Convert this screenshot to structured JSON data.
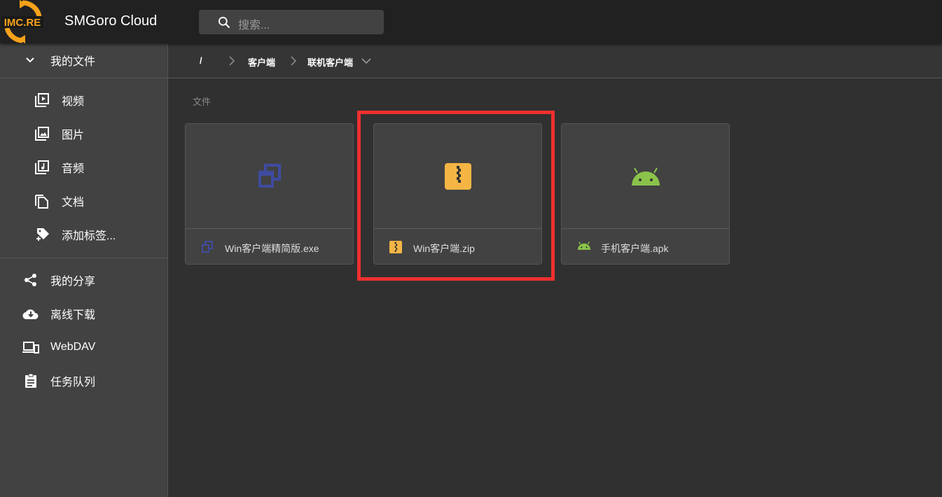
{
  "header": {
    "logo_text": "IMC.RE",
    "title": "SMGoro Cloud",
    "search_placeholder": "搜索..."
  },
  "sidebar": {
    "my_files": "我的文件",
    "sub_items": [
      {
        "label": "视频",
        "icon": "video-library-icon"
      },
      {
        "label": "图片",
        "icon": "photo-library-icon"
      },
      {
        "label": "音频",
        "icon": "music-library-icon"
      },
      {
        "label": "文档",
        "icon": "document-copy-icon"
      },
      {
        "label": "添加标签...",
        "icon": "add-tag-icon"
      }
    ],
    "items": [
      {
        "label": "我的分享",
        "icon": "share-icon"
      },
      {
        "label": "离线下载",
        "icon": "cloud-download-icon"
      },
      {
        "label": "WebDAV",
        "icon": "devices-icon"
      },
      {
        "label": "任务队列",
        "icon": "clipboard-icon"
      }
    ]
  },
  "breadcrumb": {
    "root": "/",
    "items": [
      "客户端",
      "联机客户端"
    ]
  },
  "main": {
    "section_label": "文件",
    "files": [
      {
        "name": "Win客户端精简版.exe",
        "icon": "exe-window-icon",
        "color": "#3f4ba0"
      },
      {
        "name": "Win客户端.zip",
        "icon": "zip-archive-icon",
        "color": "#f5b545"
      },
      {
        "name": "手机客户端.apk",
        "icon": "android-icon",
        "color": "#8bc34a"
      }
    ]
  },
  "highlight_color": "#f0302f"
}
